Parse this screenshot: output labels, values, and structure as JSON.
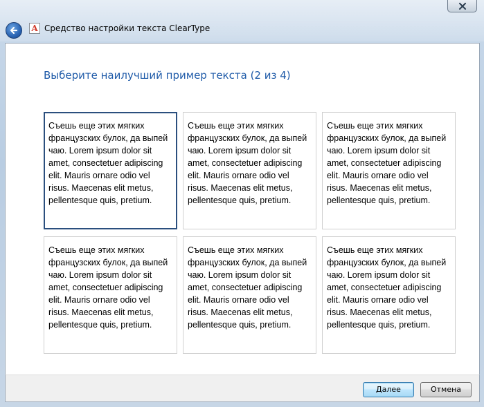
{
  "window": {
    "title": "Средство настройки текста ClearType",
    "close_icon": "close-icon",
    "back_icon": "back-arrow-icon",
    "app_icon_letter": "A"
  },
  "page": {
    "heading": "Выберите наилучший пример текста (2 из 4)"
  },
  "samples": [
    {
      "text": "Съешь еще этих мягких французских булок, да выпей чаю. Lorem ipsum dolor sit amet, consectetuer adipiscing elit. Mauris ornare odio vel risus. Maecenas elit metus, pellentesque quis, pretium.",
      "selected": true
    },
    {
      "text": "Съешь еще этих мягких французских булок, да выпей чаю. Lorem ipsum dolor sit amet, consectetuer adipiscing elit. Mauris ornare odio vel risus. Maecenas elit metus, pellentesque quis, pretium.",
      "selected": false
    },
    {
      "text": "Съешь еще этих мягких французских булок, да выпей чаю. Lorem ipsum dolor sit amet, consectetuer adipiscing elit. Mauris ornare odio vel risus. Maecenas elit metus, pellentesque quis, pretium.",
      "selected": false
    },
    {
      "text": "Съешь еще этих мягких французских булок, да выпей чаю. Lorem ipsum dolor sit amet, consectetuer adipiscing elit. Mauris ornare odio vel risus. Maecenas elit metus, pellentesque quis, pretium.",
      "selected": false
    },
    {
      "text": "Съешь еще этих мягких французских булок, да выпей чаю. Lorem ipsum dolor sit amet, consectetuer adipiscing elit. Mauris ornare odio vel risus. Maecenas elit metus, pellentesque quis, pretium.",
      "selected": false
    },
    {
      "text": "Съешь еще этих мягких французских булок, да выпей чаю. Lorem ipsum dolor sit amet, consectetuer adipiscing elit. Mauris ornare odio vel risus. Maecenas elit metus, pellentesque quis, pretium.",
      "selected": false
    }
  ],
  "footer": {
    "next_label": "Далее",
    "cancel_label": "Отмена"
  },
  "colors": {
    "heading": "#1e5aa8",
    "selected_border": "#2b4f7e"
  }
}
